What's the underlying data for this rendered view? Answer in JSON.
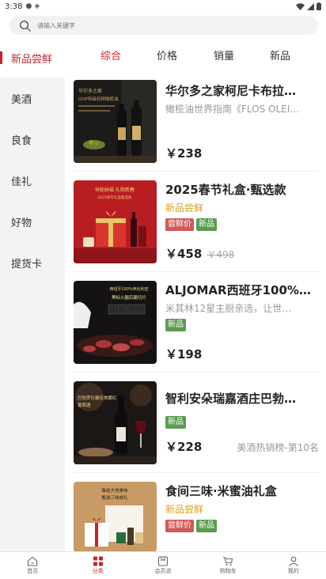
{
  "status": {
    "time": "3:38"
  },
  "search": {
    "placeholder": "请输入关键字"
  },
  "left_categories": [
    "新品尝鲜",
    "美酒",
    "良食",
    "佳礼",
    "好物",
    "提货卡"
  ],
  "sort_tabs": [
    "综合",
    "价格",
    "销量",
    "新品"
  ],
  "products": [
    {
      "title": "华尔多之家柯尼卡布拉…",
      "subtitle": "橄榄油世界指南《FLOS OLEI…",
      "subtitle_style": "grey",
      "tags": [],
      "price": "￥238",
      "original_price": "",
      "rank": "",
      "image_text": [
        "华尔多之家",
        "DOP特级初榨橄榄油"
      ]
    },
    {
      "title": "2025春节礼盒·甄选款",
      "subtitle": "新品尝鲜",
      "subtitle_style": "gold",
      "tags": [
        "尝鲜价",
        "新品"
      ],
      "price": "￥458",
      "original_price": "￥498",
      "rank": "",
      "image_text": [
        "祥蛇纳福 礼购新春",
        "2025新年礼盒甄选款"
      ]
    },
    {
      "title": "ALJOMAR西班牙100%…",
      "subtitle": "米其林12星主厨亲选，让世…",
      "subtitle_style": "grey",
      "tags": [
        "新品"
      ],
      "price": "￥198",
      "original_price": "",
      "rank": "",
      "image_text": [
        "西班牙100%伊比利亚",
        "黑标火腿后腿切片"
      ]
    },
    {
      "title": "智利安朵瑞嘉酒庄巴勃…",
      "subtitle": "",
      "subtitle_style": "grey",
      "tags": [
        "新品"
      ],
      "price": "￥228",
      "original_price": "",
      "rank": "美酒热销榜-第10名",
      "image_text": [
        "巴勃罗珍藏佳美娜红",
        "葡萄酒"
      ]
    },
    {
      "title": "食间三味·米蜜油礼盒",
      "subtitle": "新品尝鲜",
      "subtitle_style": "gold",
      "tags": [
        "尝鲜价",
        "新品"
      ],
      "price": "",
      "original_price": "",
      "rank": "",
      "image_text": [
        "集结大地美味",
        "甄选三味成礼"
      ]
    }
  ],
  "bottom_nav": [
    {
      "label": "首页",
      "icon": "home-icon"
    },
    {
      "label": "分类",
      "icon": "category-icon"
    },
    {
      "label": "会员说",
      "icon": "member-icon"
    },
    {
      "label": "购物车",
      "icon": "cart-icon"
    },
    {
      "label": "我的",
      "icon": "profile-icon"
    }
  ],
  "colors": {
    "accent": "#c8232c",
    "gold": "#d9a21b",
    "tag_red": "#d05a5a",
    "tag_green": "#5a9c4f"
  }
}
